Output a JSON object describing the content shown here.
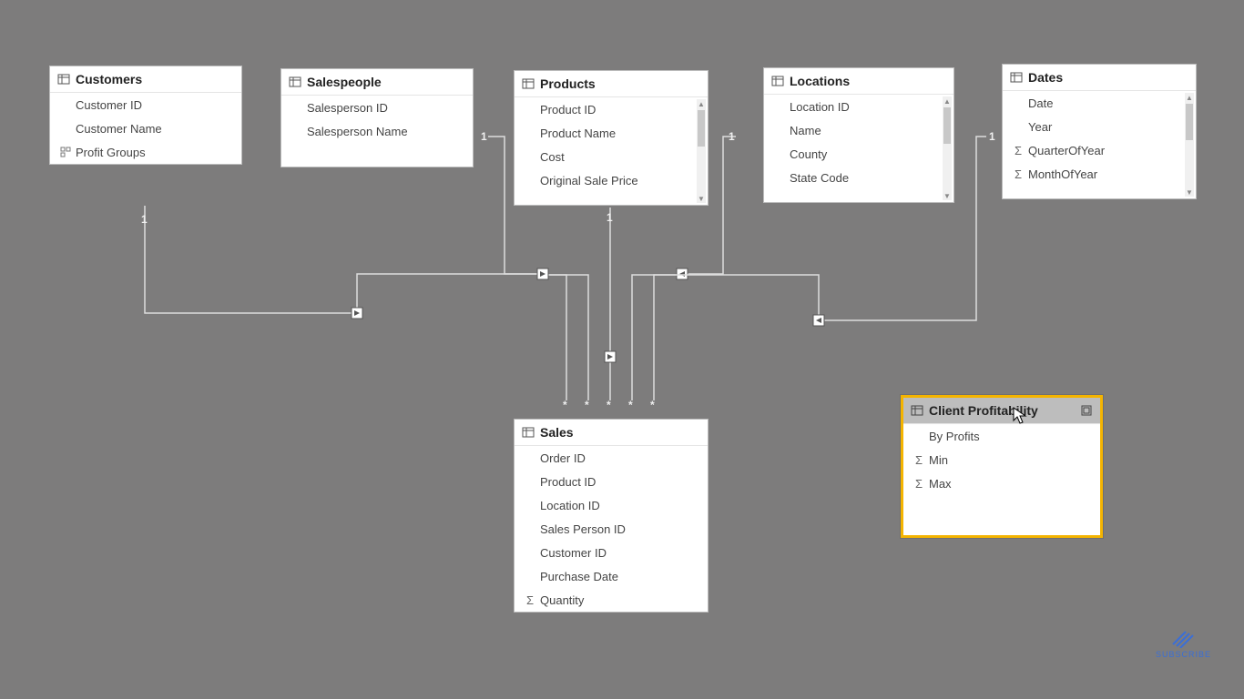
{
  "tables": {
    "customers": {
      "title": "Customers",
      "fields": [
        "Customer ID",
        "Customer Name",
        "Profit Groups"
      ]
    },
    "salespeople": {
      "title": "Salespeople",
      "fields": [
        "Salesperson ID",
        "Salesperson Name"
      ]
    },
    "products": {
      "title": "Products",
      "fields": [
        "Product ID",
        "Product Name",
        "Cost",
        "Original Sale Price"
      ]
    },
    "locations": {
      "title": "Locations",
      "fields": [
        "Location ID",
        "Name",
        "County",
        "State Code"
      ]
    },
    "dates": {
      "title": "Dates",
      "fields": [
        "Date",
        "Year",
        "QuarterOfYear",
        "MonthOfYear"
      ]
    },
    "sales": {
      "title": "Sales",
      "fields": [
        "Order ID",
        "Product ID",
        "Location ID",
        "Sales Person ID",
        "Customer ID",
        "Purchase Date",
        "Quantity"
      ]
    },
    "client_profitability": {
      "title": "Client Profitability",
      "fields": [
        "By Profits",
        "Min",
        "Max"
      ]
    }
  },
  "cardinality": {
    "one": "1",
    "many": "*"
  },
  "subscribe_label": "SUBSCRIBE"
}
